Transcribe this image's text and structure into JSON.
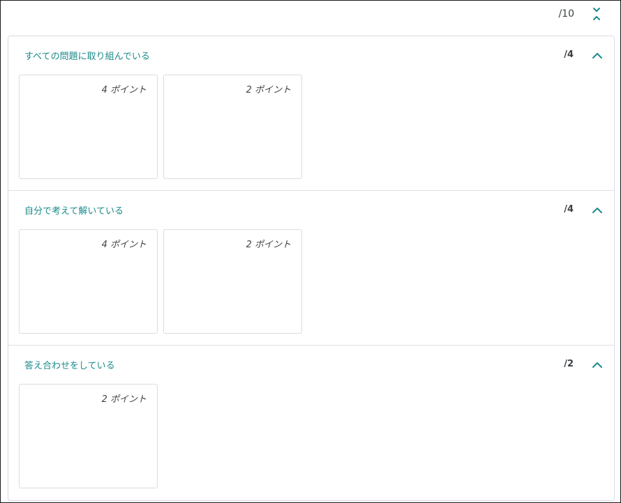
{
  "header": {
    "total": "/10",
    "collapse_icon": "double-chevron-icon"
  },
  "sections": [
    {
      "title": "すべての問題に取り組んでいる",
      "score": "/4",
      "cards": [
        {
          "points": "4 ポイント"
        },
        {
          "points": "2 ポイント"
        }
      ]
    },
    {
      "title": "自分で考えて解いている",
      "score": "/4",
      "cards": [
        {
          "points": "4 ポイント"
        },
        {
          "points": "2 ポイント"
        }
      ]
    },
    {
      "title": "答え合わせをしている",
      "score": "/2",
      "cards": [
        {
          "points": "2 ポイント"
        }
      ]
    }
  ],
  "colors": {
    "accent": "#1a8a8a",
    "border": "#dadce0",
    "text": "#3c4043"
  }
}
